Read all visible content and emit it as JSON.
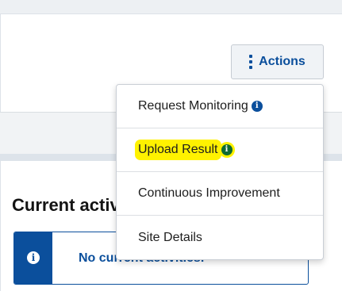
{
  "header": {
    "actions_label": "Actions"
  },
  "actions_menu": {
    "items": [
      {
        "label": "Request Monitoring",
        "info_icon": "info-circle-icon",
        "info_color": "#0b4f9c"
      },
      {
        "label": "Upload Result",
        "info_icon": "info-circle-icon",
        "info_color": "#0f6a32",
        "highlight": "#fff200"
      },
      {
        "label": "Continuous Improvement"
      },
      {
        "label": "Site Details"
      }
    ]
  },
  "content": {
    "heading": "Current activities",
    "alert": {
      "icon": "info-circle-icon",
      "text": "No current activities."
    }
  },
  "colors": {
    "brand_blue": "#0b4f9c",
    "info_green": "#0f6a32",
    "highlight_yellow": "#fff200"
  }
}
